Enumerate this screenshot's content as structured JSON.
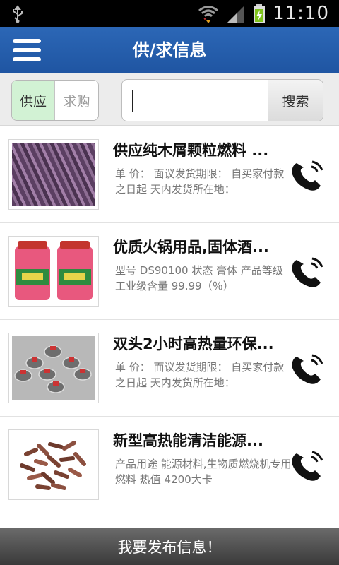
{
  "status_bar": {
    "time": "11:10",
    "icons": [
      "usb-icon",
      "wifi-icon",
      "signal-icon",
      "battery-charging-icon"
    ]
  },
  "header": {
    "title": "供/求信息",
    "menu_icon": "menu-icon"
  },
  "filter": {
    "tabs": [
      {
        "label": "供应",
        "selected": true
      },
      {
        "label": "求购",
        "selected": false
      }
    ],
    "search_value": "",
    "search_button": "搜索"
  },
  "list": {
    "items": [
      {
        "title": "供应纯木屑颗粒燃料 ...",
        "desc": "单 价： 面议发货期限： 自买家付款之日起 天内发货所在地：",
        "image": "purple-wood-pellets"
      },
      {
        "title": "优质火锅用品,固体酒...",
        "desc": "型号 DS90100 状态 膏体 产品等级 工业级含量 99.99（％）",
        "image": "solid-alcohol-jars"
      },
      {
        "title": "双头2小时高热量环保...",
        "desc": "单 价： 面议发货期限： 自买家付款之日起 天内发货所在地：",
        "image": "fuel-cups"
      },
      {
        "title": "新型高热能清洁能源...",
        "desc": "产品用途 能源材料,生物质燃烧机专用燃料 热值 4200大卡",
        "image": "brown-biomass-pellets"
      }
    ],
    "call_icon": "phone-icon"
  },
  "footer": {
    "publish_label": "我要发布信息！"
  },
  "colors": {
    "title_bar": "#2258a6",
    "selected_tab": "#d2f2d4",
    "status_bar": "#000000",
    "bottom_bar": "#4a4a4a"
  }
}
